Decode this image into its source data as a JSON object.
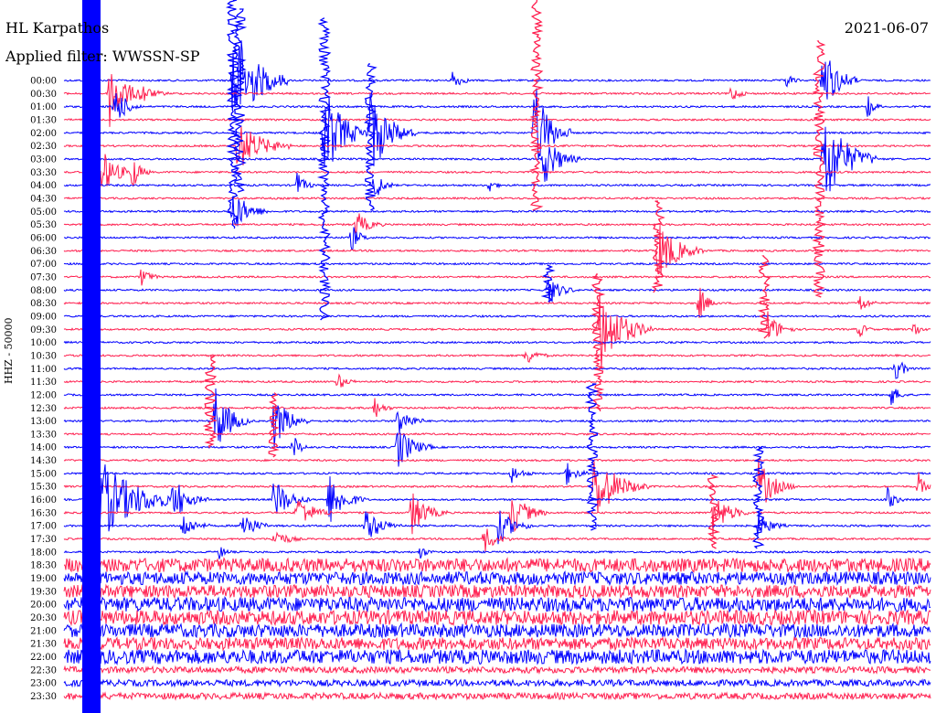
{
  "header": {
    "station": "HL Karpathos",
    "filter": "Applied filter: WWSSN-SP",
    "date": "2021-06-07"
  },
  "axis_label": "HHZ - 50000",
  "colors": {
    "trace_a": "#0000ff",
    "trace_b": "#ff2050",
    "text": "#000000",
    "background": "#ffffff"
  },
  "time_labels": [
    "00:00",
    "00:30",
    "01:00",
    "01:30",
    "02:00",
    "02:30",
    "03:00",
    "03:30",
    "04:00",
    "04:30",
    "05:00",
    "05:30",
    "06:00",
    "06:30",
    "07:00",
    "07:30",
    "08:00",
    "08:30",
    "09:00",
    "09:30",
    "10:00",
    "10:30",
    "11:00",
    "11:30",
    "12:00",
    "12:30",
    "13:00",
    "13:30",
    "14:00",
    "14:30",
    "15:00",
    "15:30",
    "16:00",
    "16:30",
    "17:00",
    "17:30",
    "18:00",
    "18:30",
    "19:00",
    "19:30",
    "20:00",
    "20:30",
    "21:00",
    "21:30",
    "22:00",
    "22:30",
    "23:00",
    "23:30"
  ]
}
